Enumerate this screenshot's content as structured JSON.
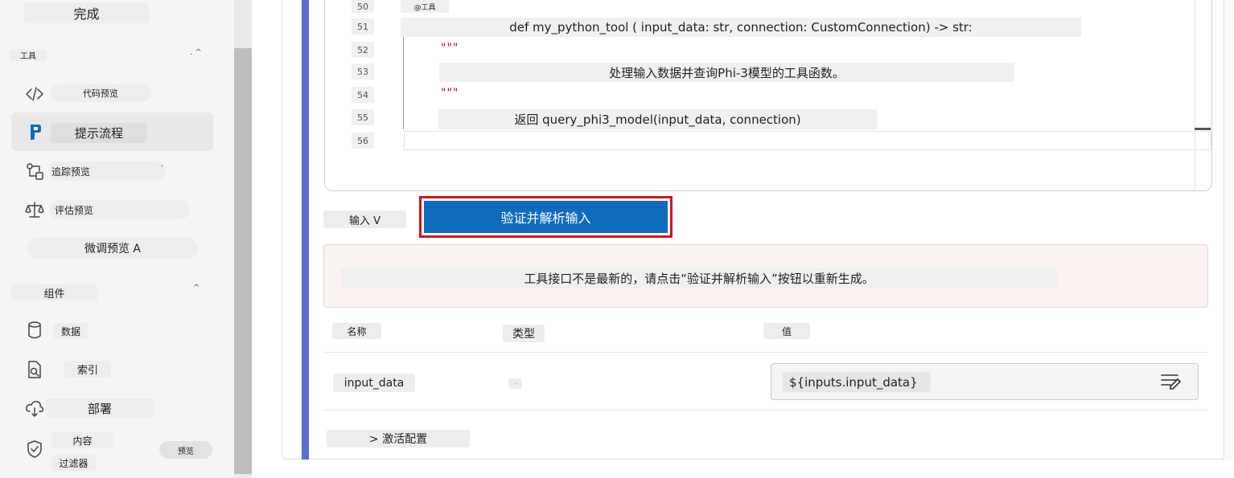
{
  "sidebar": {
    "done_label": "完成",
    "tools_section": "工具",
    "tools_chevron": ". ^",
    "items": [
      {
        "label": "代码预览",
        "icon": "code-icon"
      },
      {
        "label": "提示流程",
        "icon": "prompt-flow-icon",
        "active": true
      },
      {
        "label": "追踪预览",
        "icon": "tracing-icon",
        "suffix": "'"
      },
      {
        "label": "评估预览",
        "icon": "scale-icon"
      },
      {
        "label": "微调预览 A"
      }
    ],
    "components_section": "组件",
    "components_chevron": "^",
    "components": [
      {
        "label": "数据",
        "icon": "database-icon"
      },
      {
        "label": "索引",
        "icon": "index-search-icon"
      },
      {
        "label": "部署",
        "icon": "cloud-deploy-icon"
      }
    ],
    "content_filter": {
      "line1": "内容",
      "line2": "过滤器",
      "badge": "预览",
      "icon": "shield-check-icon"
    }
  },
  "editor": {
    "lines": [
      {
        "num": "50",
        "text": "@工具"
      },
      {
        "num": "51",
        "text": "def my_python_tool ( input_data: str, connection: CustomConnection) -> str:"
      },
      {
        "num": "52",
        "text": "\"\"\""
      },
      {
        "num": "53",
        "text": "处理输入数据并查询Phi-3模型的工具函数。"
      },
      {
        "num": "54",
        "text": "\"\"\""
      },
      {
        "num": "55",
        "text": "返回 query_phi3_model(input_data, connection)"
      },
      {
        "num": "56",
        "text": ""
      }
    ]
  },
  "inputs": {
    "toggle_label": "输入 V",
    "validate_button": "验证并解析输入",
    "warning": "工具接口不是最新的，请点击“验证并解析输入”按钮以重新生成。",
    "columns": {
      "name": "名称",
      "type": "类型",
      "value": "值"
    },
    "rows": [
      {
        "name": "input_data",
        "type": "-",
        "value": "${inputs.input_data}"
      }
    ],
    "activation_label": "> 激活配置"
  },
  "colors": {
    "accent": "#0f6cbd",
    "highlight_border": "#d4131f",
    "left_rail": "#5b6bd8",
    "warning_bg": "#fbf3f2",
    "code_string": "#a31515"
  }
}
